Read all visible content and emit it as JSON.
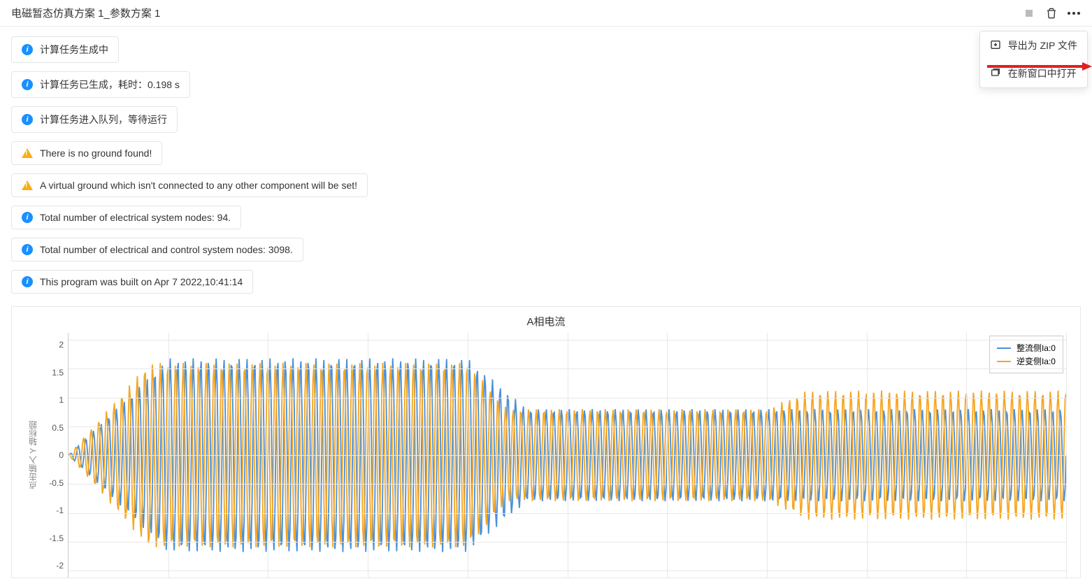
{
  "header": {
    "title": "电磁暂态仿真方案 1_参数方案 1"
  },
  "dropdown": {
    "export_zip": "导出为 ZIP 文件",
    "open_new_window": "在新窗口中打开"
  },
  "messages": [
    {
      "type": "info",
      "text": "计算任务生成中"
    },
    {
      "type": "info",
      "text": "计算任务已生成，耗时：0.198 s"
    },
    {
      "type": "info",
      "text": "计算任务进入队列，等待运行"
    },
    {
      "type": "warn",
      "text": "There is no ground found!"
    },
    {
      "type": "warn",
      "text": "A virtual ground which isn't connected to any other component will be set!"
    },
    {
      "type": "info",
      "text": "Total number of electrical system nodes: 94."
    },
    {
      "type": "info",
      "text": "Total number of electrical and control system nodes: 3098."
    },
    {
      "type": "info",
      "text": "This program was built on Apr 7 2022,10:41:14"
    }
  ],
  "chart_data": {
    "type": "line",
    "title": "A相电流",
    "ylabel": "点击输入 Y 轴标题",
    "ylim": [
      -2.5,
      2.5
    ],
    "y_ticks": [
      "2",
      "1.5",
      "1",
      "0.5",
      "0",
      "-0.5",
      "-1",
      "-1.5",
      "-2"
    ],
    "series": [
      {
        "name": "整流侧Ia:0",
        "color": "#4a90d9",
        "description": "Sinusoidal ~50Hz, amplitude rises 0→~2.1 over x∈[0,0.1], holds ~2.1 over [0.1,0.4], decays to ~1.0 over [0.4,0.46], holds ~1.0 over [0.46,1.0]"
      },
      {
        "name": "逆变侧Ia:0",
        "color": "#f5a623",
        "description": "Sinusoidal ~50Hz phase-shifted, amplitude rises 0→~2.0 over x∈[0,0.08], holds ~2.0 over [0.08,0.4], decays to ~1.0 over [0.4,0.44], ~1.0 over [0.44,0.7], rises to ~1.4 over [0.7,0.74], holds ~1.4 over [0.74,1.0]"
      }
    ],
    "x_range": [
      0,
      1
    ],
    "x_grid_divisions": 10
  }
}
